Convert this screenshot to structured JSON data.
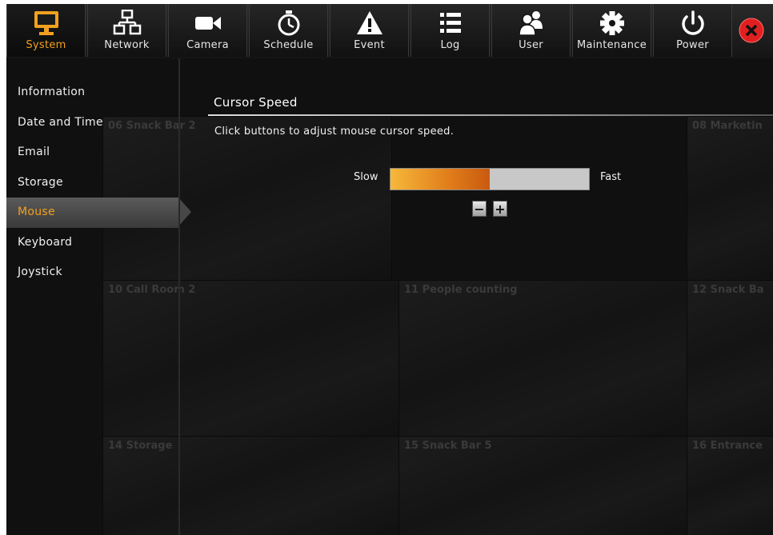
{
  "toolbar": {
    "tabs": [
      {
        "label": "System",
        "icon": "monitor-icon",
        "active": true
      },
      {
        "label": "Network",
        "icon": "network-icon",
        "active": false
      },
      {
        "label": "Camera",
        "icon": "video-camera-icon",
        "active": false
      },
      {
        "label": "Schedule",
        "icon": "stopwatch-icon",
        "active": false
      },
      {
        "label": "Event",
        "icon": "warning-icon",
        "active": false
      },
      {
        "label": "Log",
        "icon": "list-icon",
        "active": false
      },
      {
        "label": "User",
        "icon": "users-icon",
        "active": false
      },
      {
        "label": "Maintenance",
        "icon": "gear-icon",
        "active": false
      },
      {
        "label": "Power",
        "icon": "power-icon",
        "active": false
      }
    ],
    "close_icon": "close-icon"
  },
  "sidebar": {
    "items": [
      {
        "label": "Information"
      },
      {
        "label": "Date and Time"
      },
      {
        "label": "Email"
      },
      {
        "label": "Storage"
      },
      {
        "label": "Mouse",
        "active": true
      },
      {
        "label": "Keyboard"
      },
      {
        "label": "Joystick"
      }
    ]
  },
  "content": {
    "title": "Cursor Speed",
    "description": "Click buttons to adjust mouse cursor speed.",
    "slow_label": "Slow",
    "fast_label": "Fast",
    "speed_fraction": 0.5,
    "minus_label": "−",
    "plus_label": "+"
  },
  "background_cameras": [
    "06 Snack Bar 2",
    "08 Marketin",
    "10 Call Room 2",
    "11 People counting",
    "12 Snack Ba",
    "14 Storage",
    "15 Snack Bar 5",
    "16 Entrance"
  ],
  "colors": {
    "accent": "#f0a020",
    "background": "#101010",
    "close": "#e02020"
  }
}
